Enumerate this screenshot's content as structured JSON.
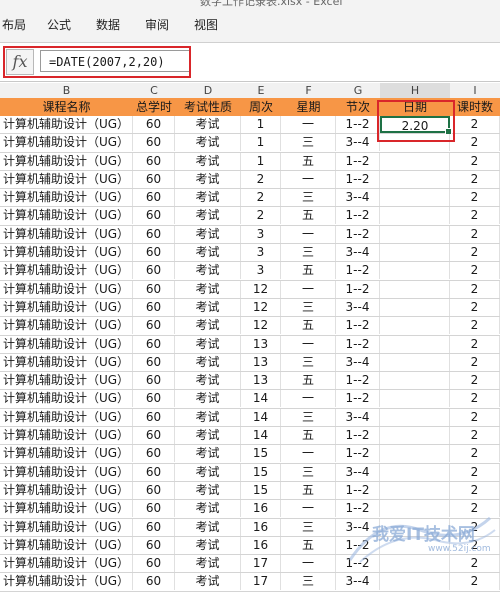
{
  "window": {
    "title": "数字工作记录表.xlsx - Excel"
  },
  "ribbon": {
    "tabs": [
      "布局",
      "公式",
      "数据",
      "审阅",
      "视图"
    ]
  },
  "formula_bar": {
    "fx_label": "fx",
    "formula": "=DATE(2007,2,20)"
  },
  "column_letters": [
    "B",
    "C",
    "D",
    "E",
    "F",
    "G",
    "H",
    "I"
  ],
  "header": {
    "name": "课程名称",
    "hours": "总学时",
    "exam": "考试性质",
    "week": "周次",
    "weekday": "星期",
    "period": "节次",
    "date": "日期",
    "count": "课时数"
  },
  "rows": [
    {
      "name": "计算机辅助设计（UG）",
      "hours": "60",
      "exam": "考试",
      "week": "1",
      "weekday": "一",
      "period": "1--2",
      "date": "2.20",
      "count": "2"
    },
    {
      "name": "计算机辅助设计（UG）",
      "hours": "60",
      "exam": "考试",
      "week": "1",
      "weekday": "三",
      "period": "3--4",
      "date": "",
      "count": "2"
    },
    {
      "name": "计算机辅助设计（UG）",
      "hours": "60",
      "exam": "考试",
      "week": "1",
      "weekday": "五",
      "period": "1--2",
      "date": "",
      "count": "2"
    },
    {
      "name": "计算机辅助设计（UG）",
      "hours": "60",
      "exam": "考试",
      "week": "2",
      "weekday": "一",
      "period": "1--2",
      "date": "",
      "count": "2"
    },
    {
      "name": "计算机辅助设计（UG）",
      "hours": "60",
      "exam": "考试",
      "week": "2",
      "weekday": "三",
      "period": "3--4",
      "date": "",
      "count": "2"
    },
    {
      "name": "计算机辅助设计（UG）",
      "hours": "60",
      "exam": "考试",
      "week": "2",
      "weekday": "五",
      "period": "1--2",
      "date": "",
      "count": "2"
    },
    {
      "name": "计算机辅助设计（UG）",
      "hours": "60",
      "exam": "考试",
      "week": "3",
      "weekday": "一",
      "period": "1--2",
      "date": "",
      "count": "2"
    },
    {
      "name": "计算机辅助设计（UG）",
      "hours": "60",
      "exam": "考试",
      "week": "3",
      "weekday": "三",
      "period": "3--4",
      "date": "",
      "count": "2"
    },
    {
      "name": "计算机辅助设计（UG）",
      "hours": "60",
      "exam": "考试",
      "week": "3",
      "weekday": "五",
      "period": "1--2",
      "date": "",
      "count": "2"
    },
    {
      "name": "计算机辅助设计（UG）",
      "hours": "60",
      "exam": "考试",
      "week": "12",
      "weekday": "一",
      "period": "1--2",
      "date": "",
      "count": "2"
    },
    {
      "name": "计算机辅助设计（UG）",
      "hours": "60",
      "exam": "考试",
      "week": "12",
      "weekday": "三",
      "period": "3--4",
      "date": "",
      "count": "2"
    },
    {
      "name": "计算机辅助设计（UG）",
      "hours": "60",
      "exam": "考试",
      "week": "12",
      "weekday": "五",
      "period": "1--2",
      "date": "",
      "count": "2"
    },
    {
      "name": "计算机辅助设计（UG）",
      "hours": "60",
      "exam": "考试",
      "week": "13",
      "weekday": "一",
      "period": "1--2",
      "date": "",
      "count": "2"
    },
    {
      "name": "计算机辅助设计（UG）",
      "hours": "60",
      "exam": "考试",
      "week": "13",
      "weekday": "三",
      "period": "3--4",
      "date": "",
      "count": "2"
    },
    {
      "name": "计算机辅助设计（UG）",
      "hours": "60",
      "exam": "考试",
      "week": "13",
      "weekday": "五",
      "period": "1--2",
      "date": "",
      "count": "2"
    },
    {
      "name": "计算机辅助设计（UG）",
      "hours": "60",
      "exam": "考试",
      "week": "14",
      "weekday": "一",
      "period": "1--2",
      "date": "",
      "count": "2"
    },
    {
      "name": "计算机辅助设计（UG）",
      "hours": "60",
      "exam": "考试",
      "week": "14",
      "weekday": "三",
      "period": "3--4",
      "date": "",
      "count": "2"
    },
    {
      "name": "计算机辅助设计（UG）",
      "hours": "60",
      "exam": "考试",
      "week": "14",
      "weekday": "五",
      "period": "1--2",
      "date": "",
      "count": "2"
    },
    {
      "name": "计算机辅助设计（UG）",
      "hours": "60",
      "exam": "考试",
      "week": "15",
      "weekday": "一",
      "period": "1--2",
      "date": "",
      "count": "2"
    },
    {
      "name": "计算机辅助设计（UG）",
      "hours": "60",
      "exam": "考试",
      "week": "15",
      "weekday": "三",
      "period": "3--4",
      "date": "",
      "count": "2"
    },
    {
      "name": "计算机辅助设计（UG）",
      "hours": "60",
      "exam": "考试",
      "week": "15",
      "weekday": "五",
      "period": "1--2",
      "date": "",
      "count": "2"
    },
    {
      "name": "计算机辅助设计（UG）",
      "hours": "60",
      "exam": "考试",
      "week": "16",
      "weekday": "一",
      "period": "1--2",
      "date": "",
      "count": "2"
    },
    {
      "name": "计算机辅助设计（UG）",
      "hours": "60",
      "exam": "考试",
      "week": "16",
      "weekday": "三",
      "period": "3--4",
      "date": "",
      "count": "2"
    },
    {
      "name": "计算机辅助设计（UG）",
      "hours": "60",
      "exam": "考试",
      "week": "16",
      "weekday": "五",
      "period": "1--2",
      "date": "",
      "count": "2"
    },
    {
      "name": "计算机辅助设计（UG）",
      "hours": "60",
      "exam": "考试",
      "week": "17",
      "weekday": "一",
      "period": "1--2",
      "date": "",
      "count": "2"
    },
    {
      "name": "计算机辅助设计（UG）",
      "hours": "60",
      "exam": "考试",
      "week": "17",
      "weekday": "三",
      "period": "3--4",
      "date": "",
      "count": "2"
    }
  ],
  "watermark": {
    "text": "我爱IT技术网",
    "url": "www.52ij.com"
  },
  "colors": {
    "header_fill": "#f79646",
    "highlight": "#d9262a",
    "selection": "#1e7145"
  }
}
